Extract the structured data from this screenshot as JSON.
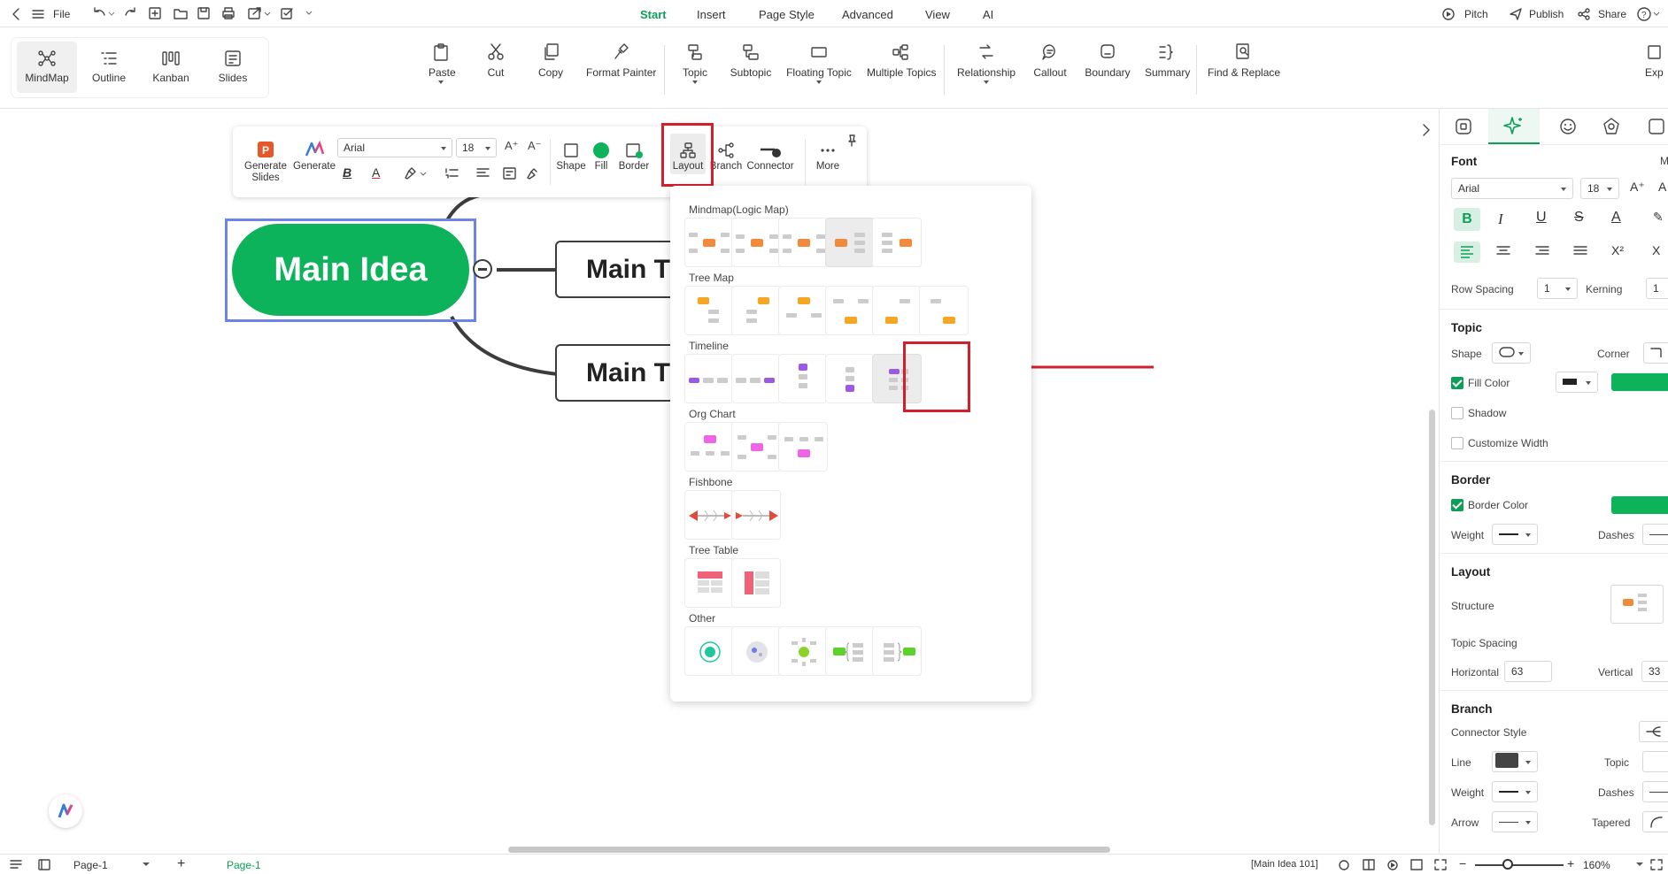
{
  "menubar": {
    "file_label": "File",
    "tabs": [
      {
        "label": "Start",
        "active": true
      },
      {
        "label": "Insert"
      },
      {
        "label": "Page Style"
      },
      {
        "label": "Advanced"
      },
      {
        "label": "View"
      },
      {
        "label": "AI"
      }
    ],
    "pitch_label": "Pitch",
    "publish_label": "Publish",
    "share_label": "Share"
  },
  "ribbon": {
    "views": [
      "MindMap",
      "Outline",
      "Kanban",
      "Slides"
    ],
    "buttons": {
      "paste": "Paste",
      "cut": "Cut",
      "copy": "Copy",
      "format_painter": "Format Painter",
      "topic": "Topic",
      "subtopic": "Subtopic",
      "floating_topic": "Floating Topic",
      "multiple_topics": "Multiple Topics",
      "relationship": "Relationship",
      "callout": "Callout",
      "boundary": "Boundary",
      "summary": "Summary",
      "find_replace": "Find & Replace",
      "export": "Exp"
    }
  },
  "floatbar": {
    "generate_slides_1": "Generate",
    "generate_slides_2": "Slides",
    "generate": "Generate",
    "font": "Arial",
    "size": "18",
    "shape": "Shape",
    "fill": "Fill",
    "border": "Border",
    "layout": "Layout",
    "branch": "Branch",
    "connector": "Connector",
    "more": "More"
  },
  "mindmap": {
    "main_idea": "Main Idea",
    "topic1": "Main T",
    "topic2": "Main T",
    "main_color": "#0db35a"
  },
  "layout_popup": {
    "sections": [
      "Mindmap(Logic Map)",
      "Tree Map",
      "Timeline",
      "Org Chart",
      "Fishbone",
      "Tree Table",
      "Other"
    ]
  },
  "right_panel": {
    "font": {
      "title": "Font",
      "family": "Arial",
      "size": "18",
      "row_spacing_label": "Row Spacing",
      "row_spacing": "1",
      "kerning_label": "Kerning",
      "kerning": "1",
      "cut_m": "M"
    },
    "topic": {
      "title": "Topic",
      "shape_label": "Shape",
      "corner_label": "Corner",
      "fill_color_label": "Fill Color",
      "shadow_label": "Shadow",
      "customize_width_label": "Customize Width",
      "fill_color": "#0db35a"
    },
    "border": {
      "title": "Border",
      "border_color_label": "Border Color",
      "weight_label": "Weight",
      "dashes_label": "Dashes",
      "border_color": "#0db35a"
    },
    "layout": {
      "title": "Layout",
      "structure_label": "Structure",
      "topic_spacing_label": "Topic Spacing",
      "horizontal_label": "Horizontal",
      "horizontal": "63",
      "vertical_label": "Vertical",
      "vertical": "33"
    },
    "branch": {
      "title": "Branch",
      "connector_style_label": "Connector Style",
      "line_label": "Line",
      "topic_label": "Topic",
      "weight_label": "Weight",
      "dashes_label": "Dashes",
      "arrow_label": "Arrow",
      "tapered_label": "Tapered",
      "line_color": "#444444"
    }
  },
  "status": {
    "page_select": "Page-1",
    "page_tab": "Page-1",
    "selection_info": "[Main Idea 101]",
    "zoom": "160%"
  }
}
